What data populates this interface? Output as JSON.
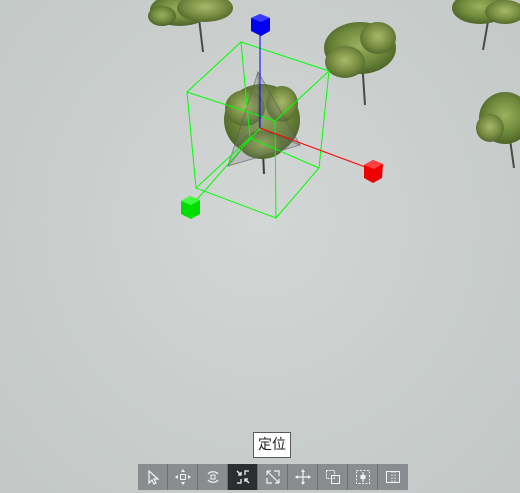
{
  "tooltip": {
    "text": "定位"
  },
  "toolbar": {
    "items": [
      {
        "name": "select-tool",
        "icon": "cursor-icon",
        "active": false
      },
      {
        "name": "move-tool",
        "icon": "move-arrows-icon",
        "active": false
      },
      {
        "name": "rotate-tool",
        "icon": "rotate-icon",
        "active": false
      },
      {
        "name": "locate-tool",
        "icon": "locate-icon",
        "active": true
      },
      {
        "name": "scale-tool",
        "icon": "scale-icon",
        "active": false
      },
      {
        "name": "pan-tool",
        "icon": "pan-icon",
        "active": false
      },
      {
        "name": "transform-tool",
        "icon": "transform-icon",
        "active": false
      },
      {
        "name": "align-tool",
        "icon": "align-icon",
        "active": false
      },
      {
        "name": "frame-tool",
        "icon": "frame-icon",
        "active": false
      }
    ]
  },
  "gizmo": {
    "x_axis_color": "#ff0000",
    "y_axis_color": "#0000ff",
    "z_axis_color": "#00ff00",
    "bounding_box_color": "#00ff00"
  }
}
